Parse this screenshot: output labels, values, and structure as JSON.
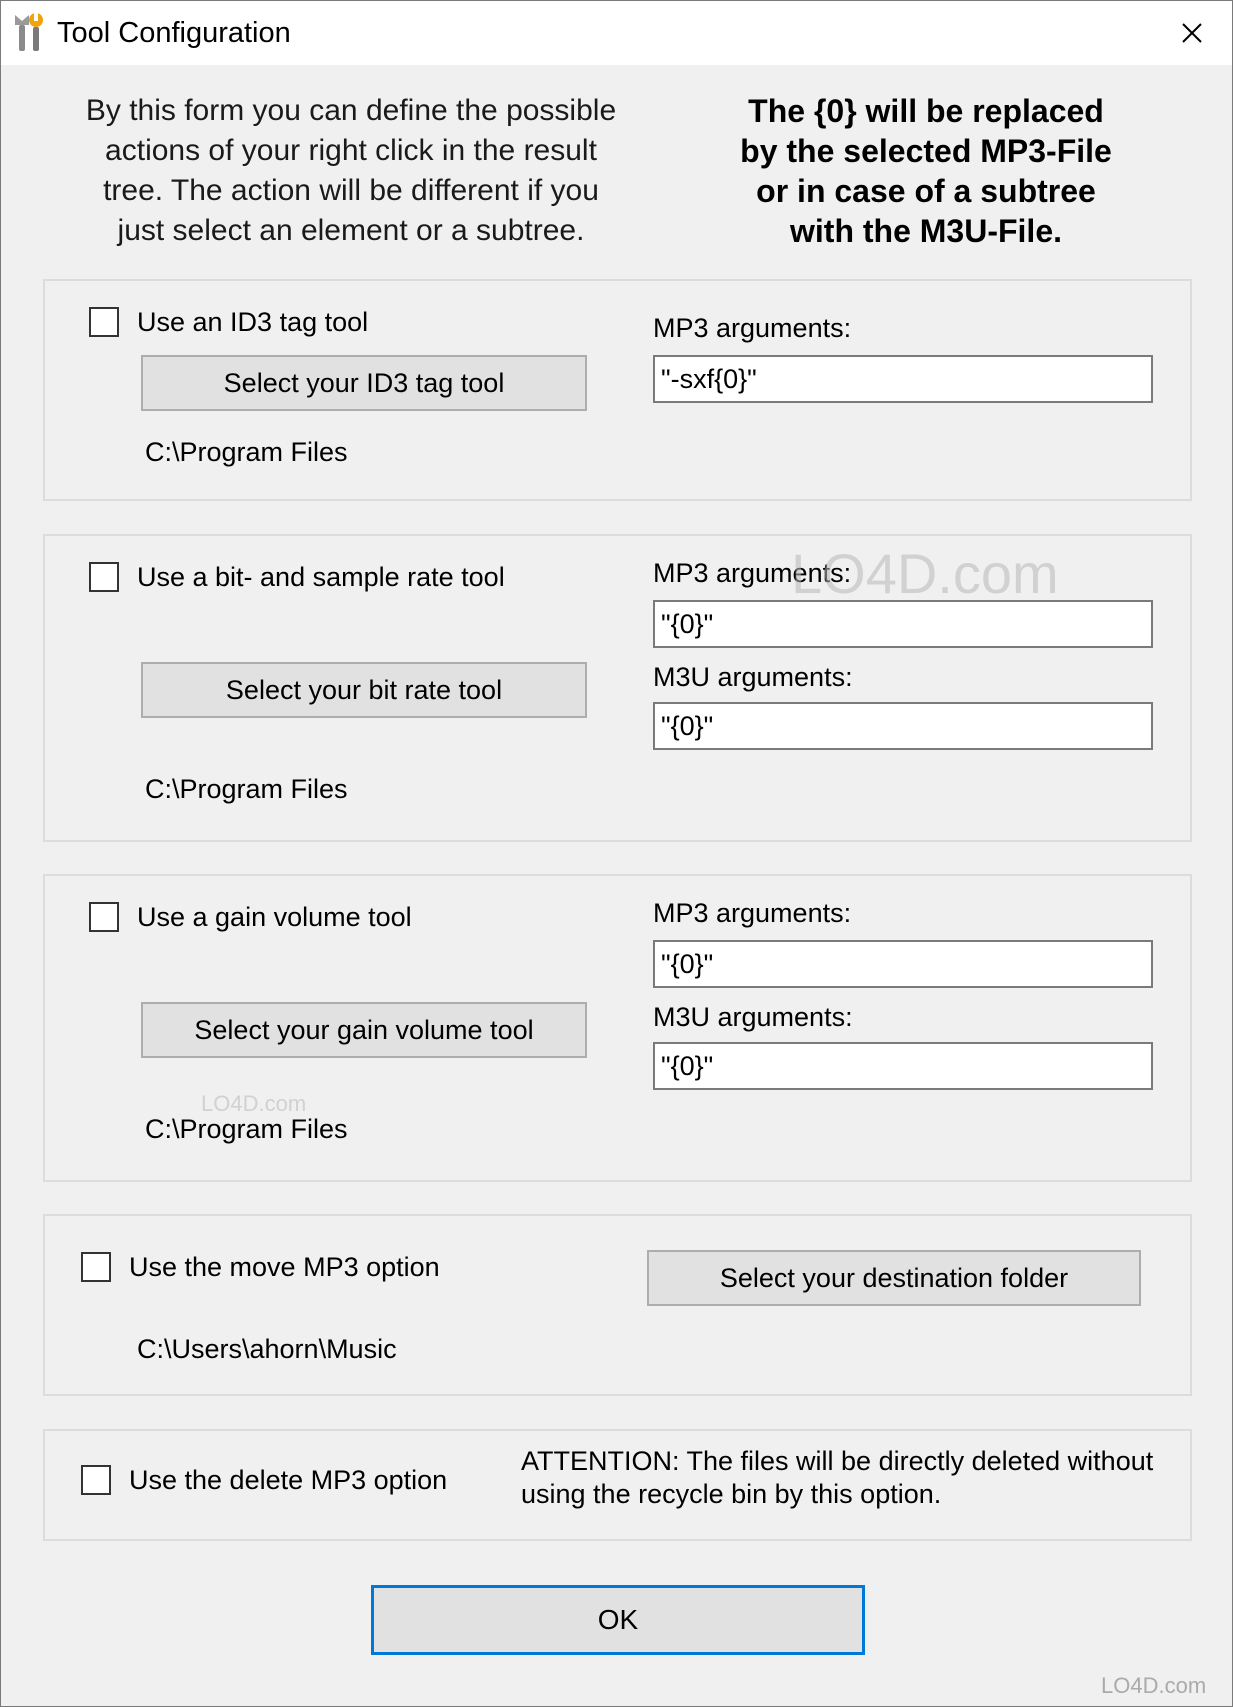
{
  "window": {
    "title": "Tool Configuration"
  },
  "intro": {
    "left_lines": [
      "By this form you can define the possible",
      "actions of your right click in the result",
      "tree. The action will be different if you",
      "just select an element or a subtree."
    ],
    "right_lines": [
      "The {0} will be replaced",
      "by the selected MP3-File",
      "or in case of a subtree",
      "with the M3U-File."
    ]
  },
  "id3": {
    "checkbox_label": "Use an ID3 tag tool",
    "checked": false,
    "button_label": "Select your ID3 tag tool",
    "path": "C:\\Program Files",
    "mp3_label": "MP3 arguments:",
    "mp3_value": "\"-sxf{0}\""
  },
  "bitrate": {
    "checkbox_label": "Use a bit- and sample rate tool",
    "checked": false,
    "button_label": "Select your bit rate tool",
    "path": "C:\\Program Files",
    "mp3_label": "MP3 arguments:",
    "mp3_value": "\"{0}\"",
    "m3u_label": "M3U arguments:",
    "m3u_value": "\"{0}\""
  },
  "gain": {
    "checkbox_label": "Use a gain volume tool",
    "checked": false,
    "button_label": "Select your gain volume tool",
    "path": "C:\\Program Files",
    "mp3_label": "MP3 arguments:",
    "mp3_value": "\"{0}\"",
    "m3u_label": "M3U arguments:",
    "m3u_value": "\"{0}\""
  },
  "move": {
    "checkbox_label": "Use the move MP3 option",
    "checked": false,
    "button_label": "Select your destination folder",
    "path": "C:\\Users\\ahorn\\Music"
  },
  "delete": {
    "checkbox_label": "Use the delete MP3 option",
    "checked": false,
    "attention_lines": [
      "ATTENTION: The files will be directly deleted without",
      "using the recycle bin by this option."
    ]
  },
  "ok_label": "OK",
  "watermark": {
    "text": "LO4D.com"
  },
  "colors": {
    "focus_border": "#0078d7",
    "button_face": "#e1e1e1",
    "window_bg": "#f0f0f0"
  }
}
